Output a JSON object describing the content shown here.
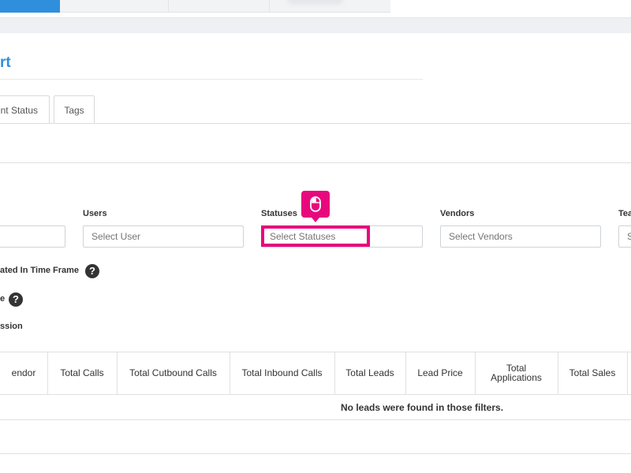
{
  "page": {
    "title": "rt"
  },
  "tabs": [
    {
      "label": "nt Status"
    },
    {
      "label": "Tags"
    }
  ],
  "filters": {
    "users": {
      "label": "Users",
      "placeholder": "Select User"
    },
    "statuses": {
      "label": "Statuses",
      "placeholder": "Select Statuses"
    },
    "vendors": {
      "label": "Vendors",
      "placeholder": "Select Vendors"
    },
    "teams": {
      "label": "Tea",
      "placeholder": "S"
    }
  },
  "options": {
    "created_in_time_frame": "ated In Time Frame",
    "option2": "e",
    "session": "ssion"
  },
  "help_glyph": "?",
  "table": {
    "headers": [
      "endor",
      "Total Calls",
      "Total Cutbound Calls",
      "Total Inbound Calls",
      "Total Leads",
      "Lead Price",
      "Total Applications",
      "Total Sales"
    ],
    "empty_message": "No leads were found in those filters."
  },
  "accent_color": "#2f8fdc",
  "highlight_color": "#e8087d",
  "cursor_icon": "mouse-icon"
}
